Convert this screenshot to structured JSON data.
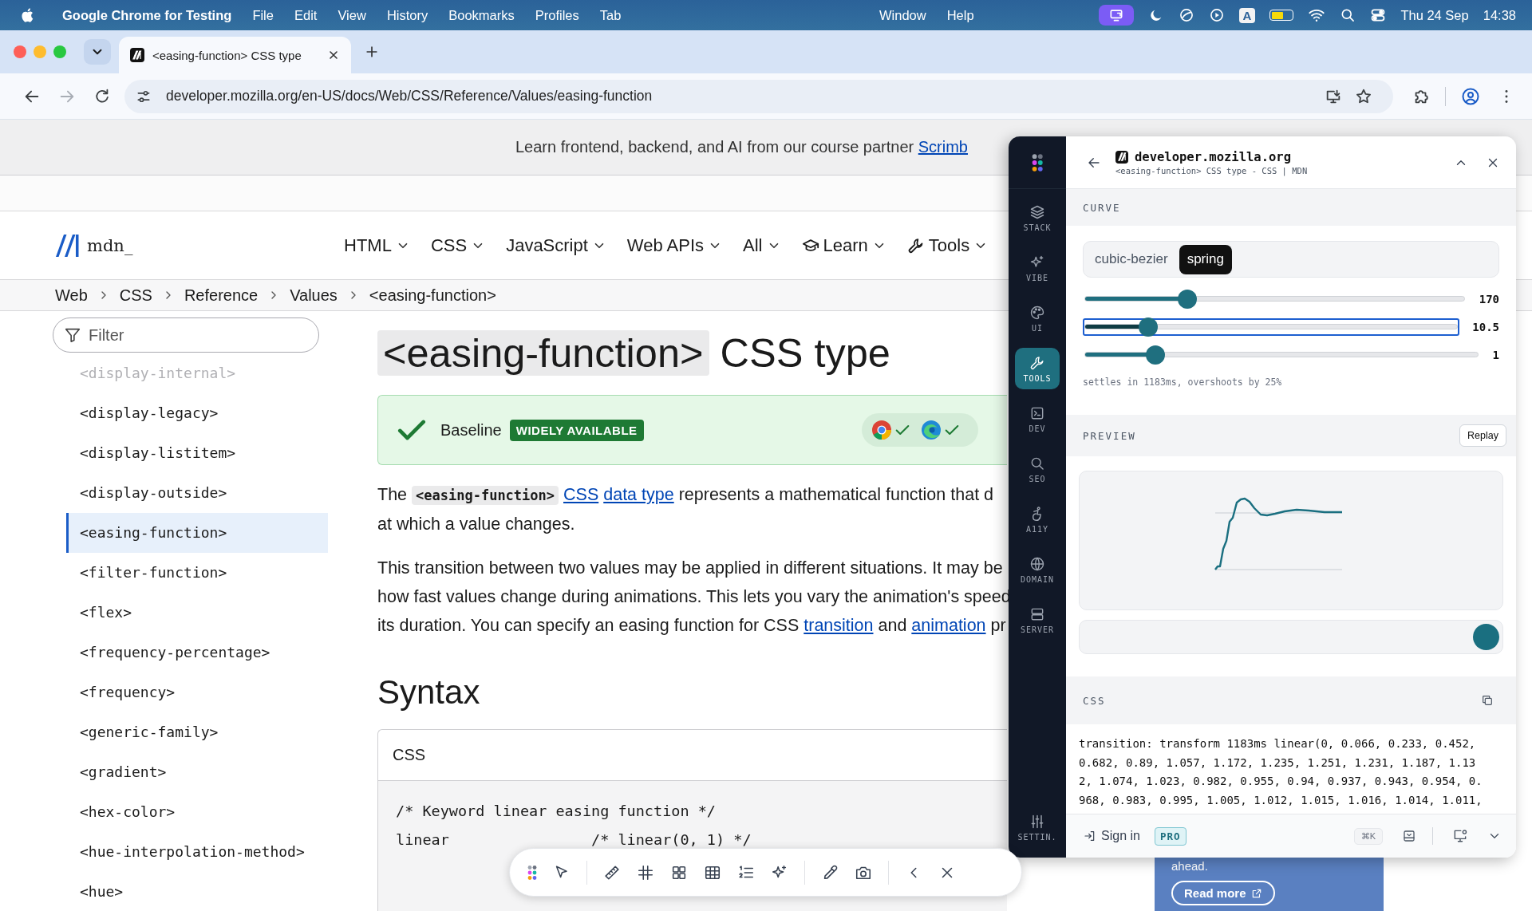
{
  "menubar": {
    "app": "Google Chrome for Testing",
    "menus": [
      "File",
      "Edit",
      "View",
      "History",
      "Bookmarks",
      "Profiles",
      "Tab"
    ],
    "menus_right": [
      "Window",
      "Help"
    ],
    "input_source": "A",
    "date": "Thu 24 Sep",
    "time": "14:38"
  },
  "browser": {
    "tab": {
      "title": "<easing-function> CSS type"
    },
    "forward_disabled": true,
    "url": "developer.mozilla.org/en-US/docs/Web/CSS/Reference/Values/easing-function"
  },
  "banner": {
    "text": "Learn frontend, backend, and AI from our course partner ",
    "link": "Scrimb"
  },
  "header": {
    "logo": "mdn_",
    "nav": [
      {
        "label": "HTML",
        "kind": "menu"
      },
      {
        "label": "CSS",
        "kind": "menu"
      },
      {
        "label": "JavaScript",
        "kind": "menu"
      },
      {
        "label": "Web APIs",
        "kind": "menu"
      },
      {
        "label": "All",
        "kind": "menu"
      },
      {
        "label": "Learn",
        "kind": "learn"
      },
      {
        "label": "Tools",
        "kind": "tools"
      }
    ]
  },
  "breadcrumbs": [
    "Web",
    "CSS",
    "Reference",
    "Values",
    "<easing-function>"
  ],
  "sidebar": {
    "filter": {
      "placeholder": "Filter"
    },
    "items": [
      {
        "label": "<display-internal>",
        "selected": false,
        "dimmed": true
      },
      {
        "label": "<display-legacy>",
        "selected": false,
        "dimmed": false
      },
      {
        "label": "<display-listitem>",
        "selected": false,
        "dimmed": false
      },
      {
        "label": "<display-outside>",
        "selected": false,
        "dimmed": false
      },
      {
        "label": "<easing-function>",
        "selected": true,
        "dimmed": false
      },
      {
        "label": "<filter-function>",
        "selected": false,
        "dimmed": false
      },
      {
        "label": "<flex>",
        "selected": false,
        "dimmed": false
      },
      {
        "label": "<frequency-percentage>",
        "selected": false,
        "dimmed": false
      },
      {
        "label": "<frequency>",
        "selected": false,
        "dimmed": false
      },
      {
        "label": "<generic-family>",
        "selected": false,
        "dimmed": false
      },
      {
        "label": "<gradient>",
        "selected": false,
        "dimmed": false
      },
      {
        "label": "<hex-color>",
        "selected": false,
        "dimmed": false
      },
      {
        "label": "<hue-interpolation-method>",
        "selected": false,
        "dimmed": false
      },
      {
        "label": "<hue>",
        "selected": false,
        "dimmed": false
      }
    ]
  },
  "article": {
    "title": {
      "code": "<easing-function>",
      "text": " CSS type"
    },
    "baseline": {
      "label": "Baseline",
      "badge": "WIDELY AVAILABLE",
      "browsers": [
        {
          "supported": true
        },
        {
          "supported": true
        }
      ]
    },
    "paragraphs": [
      [
        [
          {
            "kind": "text",
            "text": "The "
          },
          {
            "kind": "code",
            "text": "<easing-function>",
            "space_after": true
          },
          {
            "kind": "link",
            "text": "CSS",
            "space_after": true
          },
          {
            "kind": "link",
            "text": "data type"
          },
          {
            "kind": "text",
            "text": " represents a mathematical function that d"
          }
        ],
        [
          {
            "kind": "text",
            "text": "at which a value changes."
          }
        ]
      ],
      [
        [
          {
            "kind": "text",
            "text": "This transition between two values may be applied in different situations. It may be"
          }
        ],
        [
          {
            "kind": "text",
            "text": "how fast values change during animations. This lets you vary the animation's speed"
          }
        ],
        [
          {
            "kind": "text",
            "text": "its duration. You can specify an easing function for CSS "
          },
          {
            "kind": "link",
            "text": "transition"
          },
          {
            "kind": "text",
            "text": " and "
          },
          {
            "kind": "link",
            "text": "animation"
          },
          {
            "kind": "text",
            "text": " pr"
          }
        ]
      ]
    ],
    "heading": "Syntax",
    "code_block": {
      "language": "CSS",
      "lines": [
        "/* Keyword linear easing function */",
        "linear                /* linear(0, 1) */"
      ]
    }
  },
  "ad": {
    "text": "ahead.",
    "button": "Read more"
  },
  "extension": {
    "nav": [
      {
        "label": "STACK",
        "kind": "stack",
        "selected": false
      },
      {
        "label": "VIBE",
        "kind": "vibe",
        "selected": false
      },
      {
        "label": "UI",
        "kind": "ui",
        "selected": false
      },
      {
        "label": "TOOLS",
        "kind": "tools",
        "selected": true
      },
      {
        "label": "DEV",
        "kind": "dev",
        "selected": false
      },
      {
        "label": "SEO",
        "kind": "seo",
        "selected": false
      },
      {
        "label": "A11Y",
        "kind": "a11y",
        "selected": false
      },
      {
        "label": "DOMAIN",
        "kind": "domain",
        "selected": false
      },
      {
        "label": "SERVER",
        "kind": "server",
        "selected": false
      }
    ],
    "settings_label": "SETTIN.",
    "site": {
      "domain": "developer.mozilla.org",
      "title": "<easing-function> CSS type - CSS | MDN"
    },
    "curve": {
      "title": "CURVE",
      "modes": [
        {
          "label": "cubic-bezier",
          "selected": false
        },
        {
          "label": "spring",
          "selected": true
        }
      ],
      "sliders": [
        {
          "level": 0.27,
          "reading": "170",
          "focused": false
        },
        {
          "level": 0.17,
          "reading": "10.5",
          "focused": true
        },
        {
          "level": 0.18,
          "reading": "1",
          "focused": false
        }
      ],
      "summary": "settles in 1183ms, overshoots by 25%"
    },
    "preview": {
      "title": "PREVIEW",
      "button": "Replay"
    },
    "css": {
      "title": "CSS",
      "lines": [
        "transition: transform 1183ms linear(0, 0.066, 0.233, 0.452,",
        "0.682, 0.89, 1.057, 1.172, 1.235, 1.251, 1.231, 1.187, 1.13",
        "2, 1.074, 1.023, 0.982, 0.955, 0.94, 0.937, 0.943, 0.954, 0.",
        "968, 0.983, 0.995, 1.005, 1.012, 1.015, 1.016, 1.014, 1.011,"
      ]
    },
    "footer": {
      "sign_in": "Sign in",
      "badge": "PRO",
      "shortcut": "⌘K"
    }
  }
}
